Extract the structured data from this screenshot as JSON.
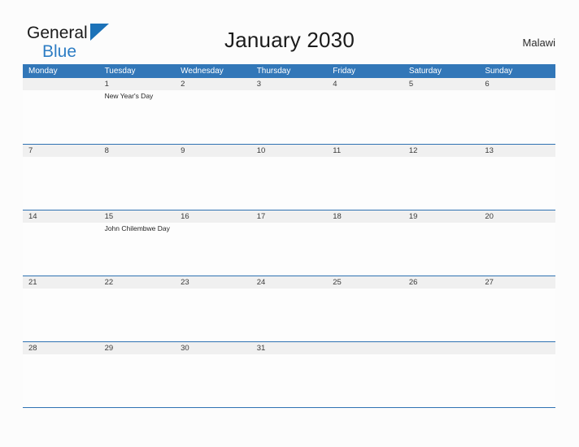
{
  "brand": {
    "name_part1": "General",
    "name_part2": "Blue",
    "flag_icon": "triangle-flag-icon",
    "accent_color": "#2d7dc4"
  },
  "header": {
    "title": "January 2030",
    "month": "January",
    "year": "2030",
    "country": "Malawi"
  },
  "theme": {
    "header_blue": "#3277b8",
    "rule_blue": "#2f72b2",
    "date_band_gray": "#f0f0f0",
    "page_background": "#fcfcfc",
    "text_color": "#202020"
  },
  "calendar": {
    "weekday_headers": [
      "Monday",
      "Tuesday",
      "Wednesday",
      "Thursday",
      "Friday",
      "Saturday",
      "Sunday"
    ],
    "weeks": [
      {
        "days": [
          {
            "date": "",
            "events": []
          },
          {
            "date": "1",
            "events": [
              "New Year's Day"
            ]
          },
          {
            "date": "2",
            "events": []
          },
          {
            "date": "3",
            "events": []
          },
          {
            "date": "4",
            "events": []
          },
          {
            "date": "5",
            "events": []
          },
          {
            "date": "6",
            "events": []
          }
        ]
      },
      {
        "days": [
          {
            "date": "7",
            "events": []
          },
          {
            "date": "8",
            "events": []
          },
          {
            "date": "9",
            "events": []
          },
          {
            "date": "10",
            "events": []
          },
          {
            "date": "11",
            "events": []
          },
          {
            "date": "12",
            "events": []
          },
          {
            "date": "13",
            "events": []
          }
        ]
      },
      {
        "days": [
          {
            "date": "14",
            "events": []
          },
          {
            "date": "15",
            "events": [
              "John Chilembwe Day"
            ]
          },
          {
            "date": "16",
            "events": []
          },
          {
            "date": "17",
            "events": []
          },
          {
            "date": "18",
            "events": []
          },
          {
            "date": "19",
            "events": []
          },
          {
            "date": "20",
            "events": []
          }
        ]
      },
      {
        "days": [
          {
            "date": "21",
            "events": []
          },
          {
            "date": "22",
            "events": []
          },
          {
            "date": "23",
            "events": []
          },
          {
            "date": "24",
            "events": []
          },
          {
            "date": "25",
            "events": []
          },
          {
            "date": "26",
            "events": []
          },
          {
            "date": "27",
            "events": []
          }
        ]
      },
      {
        "days": [
          {
            "date": "28",
            "events": []
          },
          {
            "date": "29",
            "events": []
          },
          {
            "date": "30",
            "events": []
          },
          {
            "date": "31",
            "events": []
          },
          {
            "date": "",
            "events": []
          },
          {
            "date": "",
            "events": []
          },
          {
            "date": "",
            "events": []
          }
        ]
      }
    ]
  }
}
